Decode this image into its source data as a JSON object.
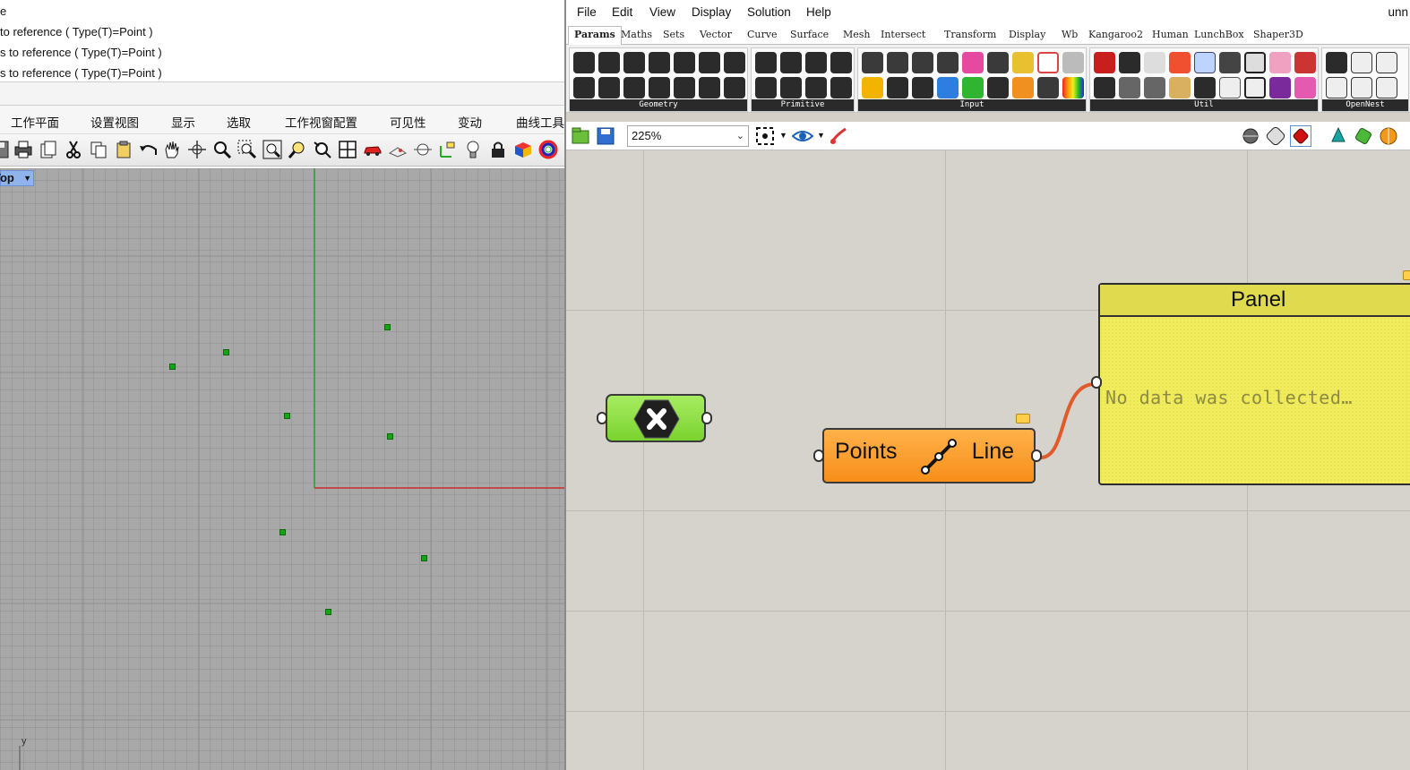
{
  "rhino": {
    "command_history": [
      "e",
      " to reference ( Type(T)=Point )",
      "s to reference ( Type(T)=Point )",
      "s to reference ( Type(T)=Point )"
    ],
    "menu": [
      "工作平面",
      "设置视图",
      "显示",
      "选取",
      "工作视窗配置",
      "可见性",
      "变动",
      "曲线工具"
    ],
    "toolbar_icons": [
      "save-icon",
      "print-icon",
      "import-icon",
      "cut-icon",
      "copy-icon",
      "paste-icon",
      "undo-icon",
      "pan-icon",
      "rotate-view-icon",
      "zoom-icon",
      "zoom-window-icon",
      "zoom-extents-icon",
      "zoom-selected-icon",
      "zoom-target-icon",
      "four-viewports-icon",
      "car-icon",
      "perspective-icon",
      "named-view-icon",
      "cplane-icon",
      "lock-icon",
      "light-icon",
      "render-icon",
      "color-wheel-icon"
    ],
    "viewport_label": "Top",
    "viewport_axis_label": "y",
    "point_color": "#15a415",
    "x_axis_color": "#cc2a2a",
    "y_axis_color": "#2aa02a"
  },
  "grasshopper": {
    "menu": [
      "File",
      "Edit",
      "View",
      "Display",
      "Solution",
      "Help"
    ],
    "title": "unn",
    "tabs": [
      "Params",
      "Maths",
      "Sets",
      "Vector",
      "Curve",
      "Surface",
      "Mesh",
      "Intersect",
      "Transform",
      "Display",
      "Wb",
      "Kangaroo2",
      "Human",
      "LunchBox",
      "Shaper3D"
    ],
    "active_tab": "Params",
    "groups": [
      "Geometry",
      "Primitive",
      "Input",
      "Util",
      "OpenNest"
    ],
    "zoom": "225%",
    "components": {
      "geometry_param": {
        "icon": "geometry-x-icon",
        "color": "#8ee040"
      },
      "line": {
        "input": "Points",
        "output": "Line",
        "icon": "line-points-icon",
        "color": "#f9a02a"
      },
      "panel": {
        "title": "Panel",
        "text": "No data was collected…",
        "color": "#f1ec5b"
      }
    },
    "wire_color": "#e05a2a"
  }
}
